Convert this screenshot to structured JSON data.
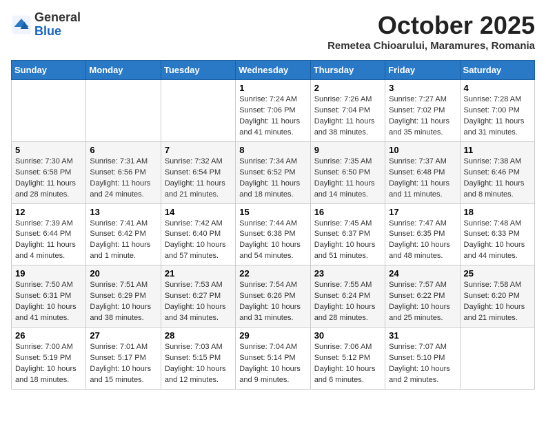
{
  "header": {
    "logo_general": "General",
    "logo_blue": "Blue",
    "month": "October 2025",
    "location": "Remetea Chioarului, Maramures, Romania"
  },
  "days_of_week": [
    "Sunday",
    "Monday",
    "Tuesday",
    "Wednesday",
    "Thursday",
    "Friday",
    "Saturday"
  ],
  "weeks": [
    [
      {
        "day": "",
        "info": ""
      },
      {
        "day": "",
        "info": ""
      },
      {
        "day": "",
        "info": ""
      },
      {
        "day": "1",
        "info": "Sunrise: 7:24 AM\nSunset: 7:06 PM\nDaylight: 11 hours and 41 minutes."
      },
      {
        "day": "2",
        "info": "Sunrise: 7:26 AM\nSunset: 7:04 PM\nDaylight: 11 hours and 38 minutes."
      },
      {
        "day": "3",
        "info": "Sunrise: 7:27 AM\nSunset: 7:02 PM\nDaylight: 11 hours and 35 minutes."
      },
      {
        "day": "4",
        "info": "Sunrise: 7:28 AM\nSunset: 7:00 PM\nDaylight: 11 hours and 31 minutes."
      }
    ],
    [
      {
        "day": "5",
        "info": "Sunrise: 7:30 AM\nSunset: 6:58 PM\nDaylight: 11 hours and 28 minutes."
      },
      {
        "day": "6",
        "info": "Sunrise: 7:31 AM\nSunset: 6:56 PM\nDaylight: 11 hours and 24 minutes."
      },
      {
        "day": "7",
        "info": "Sunrise: 7:32 AM\nSunset: 6:54 PM\nDaylight: 11 hours and 21 minutes."
      },
      {
        "day": "8",
        "info": "Sunrise: 7:34 AM\nSunset: 6:52 PM\nDaylight: 11 hours and 18 minutes."
      },
      {
        "day": "9",
        "info": "Sunrise: 7:35 AM\nSunset: 6:50 PM\nDaylight: 11 hours and 14 minutes."
      },
      {
        "day": "10",
        "info": "Sunrise: 7:37 AM\nSunset: 6:48 PM\nDaylight: 11 hours and 11 minutes."
      },
      {
        "day": "11",
        "info": "Sunrise: 7:38 AM\nSunset: 6:46 PM\nDaylight: 11 hours and 8 minutes."
      }
    ],
    [
      {
        "day": "12",
        "info": "Sunrise: 7:39 AM\nSunset: 6:44 PM\nDaylight: 11 hours and 4 minutes."
      },
      {
        "day": "13",
        "info": "Sunrise: 7:41 AM\nSunset: 6:42 PM\nDaylight: 11 hours and 1 minute."
      },
      {
        "day": "14",
        "info": "Sunrise: 7:42 AM\nSunset: 6:40 PM\nDaylight: 10 hours and 57 minutes."
      },
      {
        "day": "15",
        "info": "Sunrise: 7:44 AM\nSunset: 6:38 PM\nDaylight: 10 hours and 54 minutes."
      },
      {
        "day": "16",
        "info": "Sunrise: 7:45 AM\nSunset: 6:37 PM\nDaylight: 10 hours and 51 minutes."
      },
      {
        "day": "17",
        "info": "Sunrise: 7:47 AM\nSunset: 6:35 PM\nDaylight: 10 hours and 48 minutes."
      },
      {
        "day": "18",
        "info": "Sunrise: 7:48 AM\nSunset: 6:33 PM\nDaylight: 10 hours and 44 minutes."
      }
    ],
    [
      {
        "day": "19",
        "info": "Sunrise: 7:50 AM\nSunset: 6:31 PM\nDaylight: 10 hours and 41 minutes."
      },
      {
        "day": "20",
        "info": "Sunrise: 7:51 AM\nSunset: 6:29 PM\nDaylight: 10 hours and 38 minutes."
      },
      {
        "day": "21",
        "info": "Sunrise: 7:53 AM\nSunset: 6:27 PM\nDaylight: 10 hours and 34 minutes."
      },
      {
        "day": "22",
        "info": "Sunrise: 7:54 AM\nSunset: 6:26 PM\nDaylight: 10 hours and 31 minutes."
      },
      {
        "day": "23",
        "info": "Sunrise: 7:55 AM\nSunset: 6:24 PM\nDaylight: 10 hours and 28 minutes."
      },
      {
        "day": "24",
        "info": "Sunrise: 7:57 AM\nSunset: 6:22 PM\nDaylight: 10 hours and 25 minutes."
      },
      {
        "day": "25",
        "info": "Sunrise: 7:58 AM\nSunset: 6:20 PM\nDaylight: 10 hours and 21 minutes."
      }
    ],
    [
      {
        "day": "26",
        "info": "Sunrise: 7:00 AM\nSunset: 5:19 PM\nDaylight: 10 hours and 18 minutes."
      },
      {
        "day": "27",
        "info": "Sunrise: 7:01 AM\nSunset: 5:17 PM\nDaylight: 10 hours and 15 minutes."
      },
      {
        "day": "28",
        "info": "Sunrise: 7:03 AM\nSunset: 5:15 PM\nDaylight: 10 hours and 12 minutes."
      },
      {
        "day": "29",
        "info": "Sunrise: 7:04 AM\nSunset: 5:14 PM\nDaylight: 10 hours and 9 minutes."
      },
      {
        "day": "30",
        "info": "Sunrise: 7:06 AM\nSunset: 5:12 PM\nDaylight: 10 hours and 6 minutes."
      },
      {
        "day": "31",
        "info": "Sunrise: 7:07 AM\nSunset: 5:10 PM\nDaylight: 10 hours and 2 minutes."
      },
      {
        "day": "",
        "info": ""
      }
    ]
  ]
}
